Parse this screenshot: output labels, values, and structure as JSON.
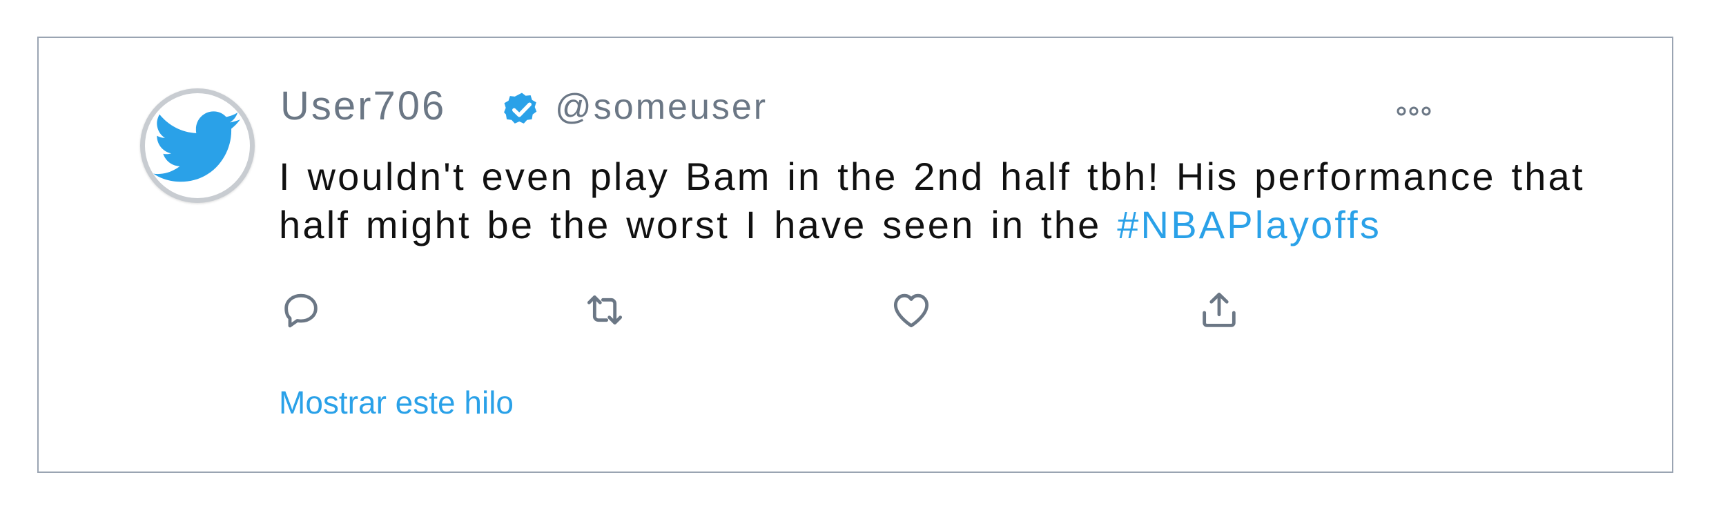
{
  "tweet": {
    "display_name": "User706",
    "handle": "@someuser",
    "text_main": "I wouldn't even play Bam in the 2nd half tbh! His performance that half might be the worst I have seen in the ",
    "hashtag": "#NBAPlayoffs",
    "show_thread_label": "Mostrar este hilo"
  },
  "icons": {
    "avatar": "twitter-bird-icon",
    "verified": "verified-badge-icon",
    "more": "more-options-icon",
    "reply": "reply-icon",
    "retweet": "retweet-icon",
    "like": "heart-icon",
    "share": "share-icon"
  },
  "colors": {
    "accent": "#2aa1e8",
    "muted_text": "#6b7785",
    "body_text": "#111111",
    "border": "#9aa4b2"
  }
}
